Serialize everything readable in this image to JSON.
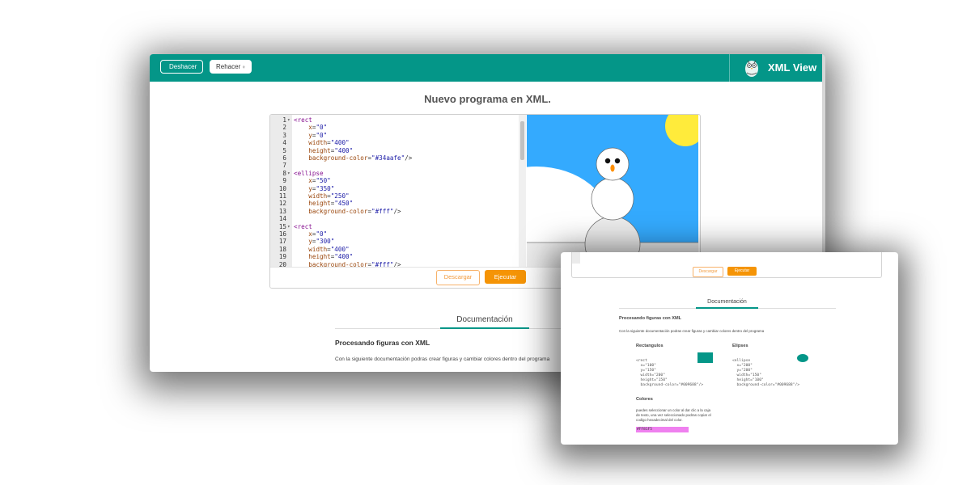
{
  "toolbar": {
    "undo_label": "Deshacer",
    "redo_label": "Rehacer",
    "undo_icon": "undo-icon",
    "redo_icon": "redo-icon"
  },
  "brand": {
    "name": "XML View",
    "logo_icon": "owl-logo-icon"
  },
  "page": {
    "title": "Nuevo programa en XML."
  },
  "editor": {
    "lines": [
      {
        "n": "1",
        "fold": true,
        "text": "<rect"
      },
      {
        "n": "2",
        "text": "    x=\"0\""
      },
      {
        "n": "3",
        "text": "    y=\"0\""
      },
      {
        "n": "4",
        "text": "    width=\"400\""
      },
      {
        "n": "5",
        "text": "    height=\"400\""
      },
      {
        "n": "6",
        "text": "    background-color=\"#34aafe\"/>"
      },
      {
        "n": "7",
        "text": ""
      },
      {
        "n": "8",
        "fold": true,
        "text": "<ellipse"
      },
      {
        "n": "9",
        "text": "    x=\"50\""
      },
      {
        "n": "10",
        "text": "    y=\"350\""
      },
      {
        "n": "11",
        "text": "    width=\"250\""
      },
      {
        "n": "12",
        "text": "    height=\"450\""
      },
      {
        "n": "13",
        "text": "    background-color=\"#fff\"/>"
      },
      {
        "n": "14",
        "text": ""
      },
      {
        "n": "15",
        "fold": true,
        "text": "<rect"
      },
      {
        "n": "16",
        "text": "    x=\"0\""
      },
      {
        "n": "17",
        "text": "    y=\"300\""
      },
      {
        "n": "18",
        "text": "    width=\"400\""
      },
      {
        "n": "19",
        "text": "    height=\"400\""
      },
      {
        "n": "20",
        "text": "    background-color=\"#fff\"/>"
      }
    ],
    "download_label": "Descargar",
    "run_label": "Ejecutar"
  },
  "documentation": {
    "tab_label": "Documentación",
    "heading": "Procesando figuras con XML",
    "intro": "Con la siguiente documentación podras crear figuras y cambiar colores dentro del programa"
  },
  "overlay": {
    "download_label": "Descargar",
    "run_label": "Ejecutar",
    "tab_label": "Documentación",
    "heading": "Procesando figuras con XML",
    "intro": "Con la siguiente documentación podras crear figuras y cambiar colores dentro del programa",
    "rect_title": "Rectangulos",
    "rect_code": "<rect\n  x=\"100\"\n  y=\"150\"\n  width=\"200\"\n  height=\"150\"\n  background-color=\"#009688\"/>",
    "ellipse_title": "Elipses",
    "ellipse_code": "<ellipse\n  x=\"200\"\n  y=\"200\"\n  width=\"150\"\n  height=\"100\"\n  background-color=\"#009688\"/>",
    "colors_title": "Colores",
    "colors_text_1": "puedes seleccionar un color al dar clic a la caja",
    "colors_text_2": "de texto, una vez seleccionado podras copiar el",
    "colors_text_3": "codigo hexadecimal del color.",
    "color_value": "#FF81F5"
  },
  "colors": {
    "primary": "#049688",
    "accent": "#f59406",
    "canvas_sky": "#34aafe",
    "sun": "#ffeb3b",
    "sample_shape": "#009688",
    "sample_color": "#ef80ef"
  }
}
